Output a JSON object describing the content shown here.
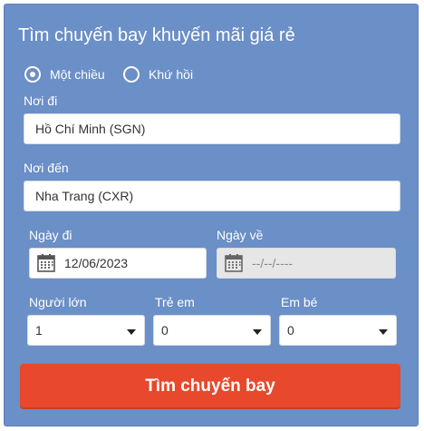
{
  "form": {
    "title": "Tìm chuyến bay khuyến mãi giá rẻ",
    "trip_type": {
      "one_way_label": "Một chiều",
      "round_trip_label": "Khứ hồi",
      "selected": "one_way"
    },
    "origin": {
      "label": "Nơi đi",
      "value": "Hồ Chí Minh (SGN)"
    },
    "destination": {
      "label": "Nơi đến",
      "value": "Nha Trang (CXR)"
    },
    "depart_date": {
      "label": "Ngày đi",
      "value": "12/06/2023"
    },
    "return_date": {
      "label": "Ngày về",
      "value": "--/--/----",
      "disabled": true
    },
    "adults": {
      "label": "Người lớn",
      "value": "1"
    },
    "children": {
      "label": "Trẻ em",
      "value": "0"
    },
    "infants": {
      "label": "Em bé",
      "value": "0"
    },
    "search_button": "Tìm chuyến bay"
  },
  "colors": {
    "panel": "#6b8fc7",
    "button": "#e8482b"
  },
  "icons": {
    "date": "calendar-icon",
    "dropdown": "chevron-down-icon"
  }
}
